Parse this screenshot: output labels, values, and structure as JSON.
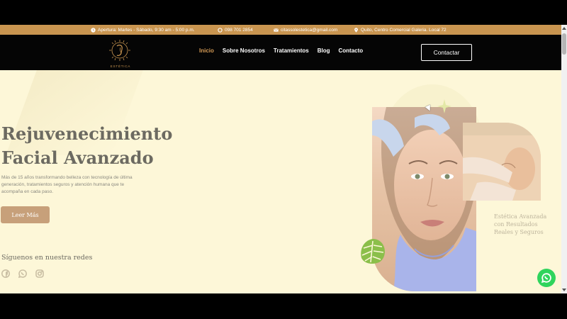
{
  "infobar": {
    "hours": "Apertura: Martes - Sábado, 9:30 am - 5:00 p.m.",
    "phone": "098 701 2854",
    "email": "citassolestetica@gmail.com",
    "address": "Quito, Centro Comercial Galeria. Local 72"
  },
  "logo": {
    "text": "ESTÉTICA"
  },
  "nav": {
    "items": [
      {
        "label": "Inicio",
        "active": true
      },
      {
        "label": "Sobre Nosotros"
      },
      {
        "label": "Tratamientos"
      },
      {
        "label": "Blog"
      },
      {
        "label": "Contacto"
      }
    ],
    "cta": "Contactar"
  },
  "hero": {
    "title_line1": "Rejuvenecimiento",
    "title_line2": "Facial Avanzado",
    "description": "Más de 15 años transformando belleza con tecnología de última generación, tratamientos seguros y atención humana que te acompaña en cada paso.",
    "button": "Leer Más",
    "follow_title": "Síguenos en nuestra redes",
    "caption": "Estética Avanzada con Resultados Reales y Seguros"
  },
  "colors": {
    "accent": "#c99550",
    "nav_bg": "#050505",
    "hero_bg": "#fdf7d8",
    "whatsapp": "#2fd45c"
  }
}
